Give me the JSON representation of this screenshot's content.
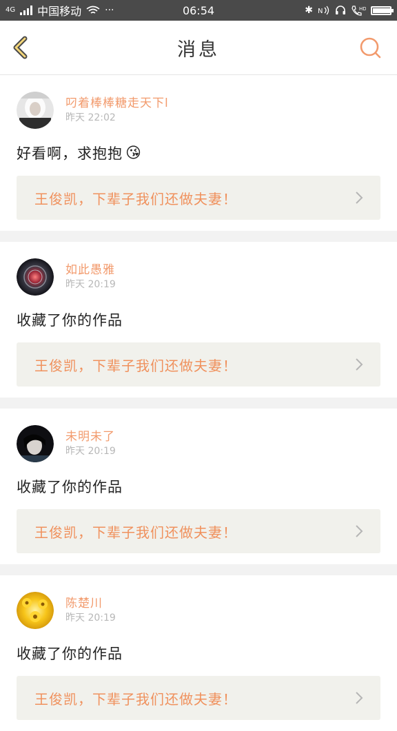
{
  "status_bar": {
    "network": "4G",
    "carrier": "中国移动",
    "time": "06:54",
    "battery_level": 0.95
  },
  "header": {
    "title": "消息",
    "back_icon": "chevron-left-icon",
    "search_icon": "search-icon"
  },
  "messages": [
    {
      "username": "叼着棒棒糖走天下l",
      "timestamp": "昨天 22:02",
      "content": "好看啊，求抱抱",
      "emoji": "😘",
      "reference": "王俊凯，下辈子我们还做夫妻！"
    },
    {
      "username": "如此愚雅",
      "timestamp": "昨天 20:19",
      "content": "收藏了你的作品",
      "reference": "王俊凯，下辈子我们还做夫妻！"
    },
    {
      "username": "未明未了",
      "timestamp": "昨天 20:19",
      "content": "收藏了你的作品",
      "reference": "王俊凯，下辈子我们还做夫妻！"
    },
    {
      "username": "陈楚川",
      "timestamp": "昨天 20:19",
      "content": "收藏了你的作品",
      "reference": "王俊凯，下辈子我们还做夫妻！"
    }
  ],
  "colors": {
    "accent": "#f29a6c",
    "status_bar_bg": "#4a4a4a",
    "ref_bg": "#f1f1ec"
  }
}
